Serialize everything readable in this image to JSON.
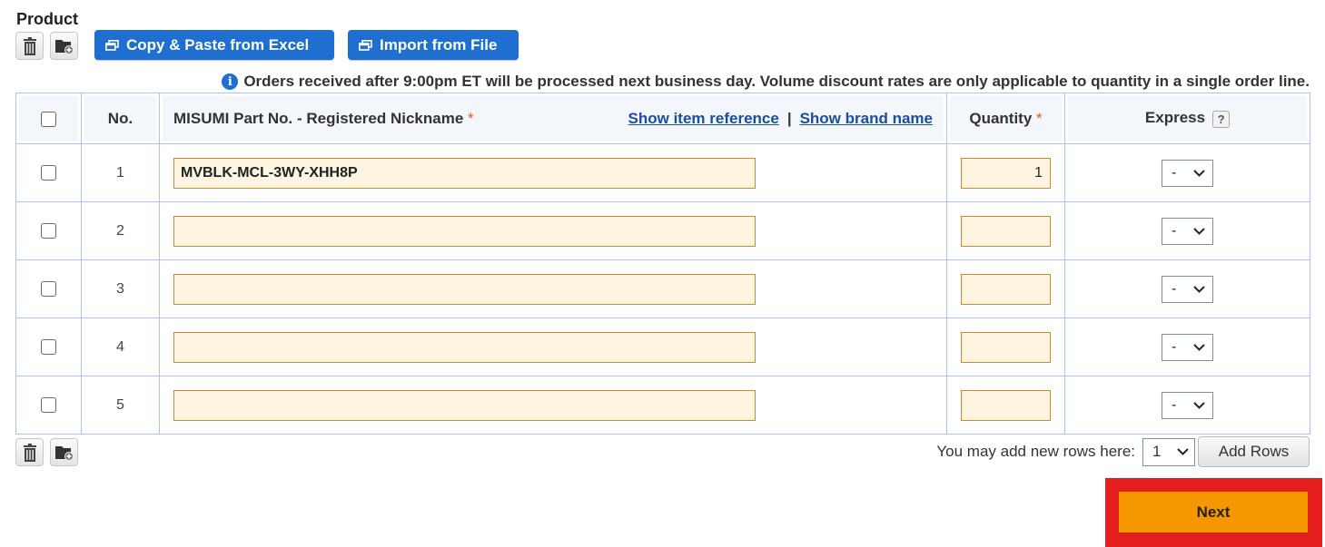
{
  "section": {
    "title": "Product"
  },
  "toolbar": {
    "delete_icon": "trash-icon",
    "add_folder_icon": "folder-add-icon",
    "copy_paste_label": "Copy & Paste from Excel",
    "import_label": "Import from File"
  },
  "notice": {
    "icon": "info-icon",
    "text": "Orders received after 9:00pm ET will be processed next business day. Volume discount rates are only applicable to quantity in a single order line."
  },
  "table": {
    "headers": {
      "no": "No.",
      "part": "MISUMI Part No. - Registered Nickname",
      "required_mark": "*",
      "show_item_reference": "Show item reference",
      "separator": "|",
      "show_brand_name": "Show brand name",
      "quantity": "Quantity",
      "express": "Express",
      "help_mark": "?"
    },
    "rows": [
      {
        "no": "1",
        "part": "MVBLK-MCL-3WY-XHH8P",
        "quantity": "1",
        "express": "-",
        "checked": false
      },
      {
        "no": "2",
        "part": "",
        "quantity": "",
        "express": "-",
        "checked": false
      },
      {
        "no": "3",
        "part": "",
        "quantity": "",
        "express": "-",
        "checked": false
      },
      {
        "no": "4",
        "part": "",
        "quantity": "",
        "express": "-",
        "checked": false
      },
      {
        "no": "5",
        "part": "",
        "quantity": "",
        "express": "-",
        "checked": false
      }
    ]
  },
  "footer": {
    "add_rows_label": "You may add new rows here:",
    "add_rows_count": "1",
    "add_rows_button": "Add Rows",
    "next_button": "Next"
  },
  "colors": {
    "primary_blue": "#1f6fd0",
    "input_bg": "#fdf5e2",
    "input_border": "#d4862a",
    "next_bg": "#f59800",
    "highlight_red": "#e41d1d"
  }
}
